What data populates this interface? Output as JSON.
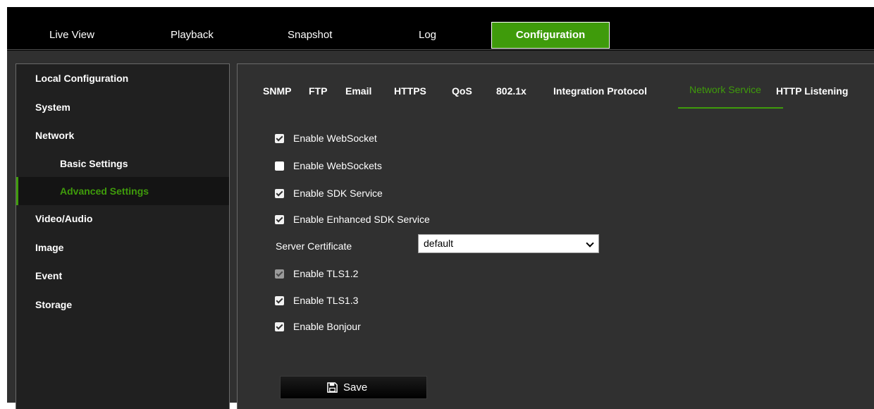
{
  "nav": {
    "items": [
      {
        "label": "Live View"
      },
      {
        "label": "Playback"
      },
      {
        "label": "Snapshot"
      },
      {
        "label": "Log"
      },
      {
        "label": "Configuration",
        "active": true
      }
    ]
  },
  "sidebar": {
    "items": [
      {
        "label": "Local Configuration"
      },
      {
        "label": "System"
      },
      {
        "label": "Network"
      },
      {
        "label": "Basic Settings"
      },
      {
        "label": "Advanced Settings",
        "active": true
      },
      {
        "label": "Video/Audio"
      },
      {
        "label": "Image"
      },
      {
        "label": "Event"
      },
      {
        "label": "Storage"
      }
    ]
  },
  "tabs": [
    {
      "label": "SNMP"
    },
    {
      "label": "FTP"
    },
    {
      "label": "Email"
    },
    {
      "label": "HTTPS"
    },
    {
      "label": "QoS"
    },
    {
      "label": "802.1x"
    },
    {
      "label": "Integration Protocol"
    },
    {
      "label": "Network Service",
      "active": true
    },
    {
      "label": "HTTP Listening"
    }
  ],
  "options": [
    {
      "label": "Enable WebSocket",
      "checked": true
    },
    {
      "label": "Enable WebSockets",
      "checked": false
    },
    {
      "label": "Enable SDK Service",
      "checked": true
    },
    {
      "label": "Enable Enhanced SDK Service",
      "checked": true
    },
    {
      "label": "Enable TLS1.2",
      "checked": true,
      "disabled": true
    },
    {
      "label": "Enable TLS1.3",
      "checked": true
    },
    {
      "label": "Enable Bonjour",
      "checked": true
    }
  ],
  "server_certificate": {
    "label": "Server Certificate",
    "value": "default"
  },
  "save_button": {
    "label": "Save",
    "icon": "floppy-disk-icon"
  },
  "colors": {
    "accent": "#3f9b0b",
    "background": "#303030",
    "sidebar_bg": "#202020",
    "nav_bg": "#000000"
  }
}
